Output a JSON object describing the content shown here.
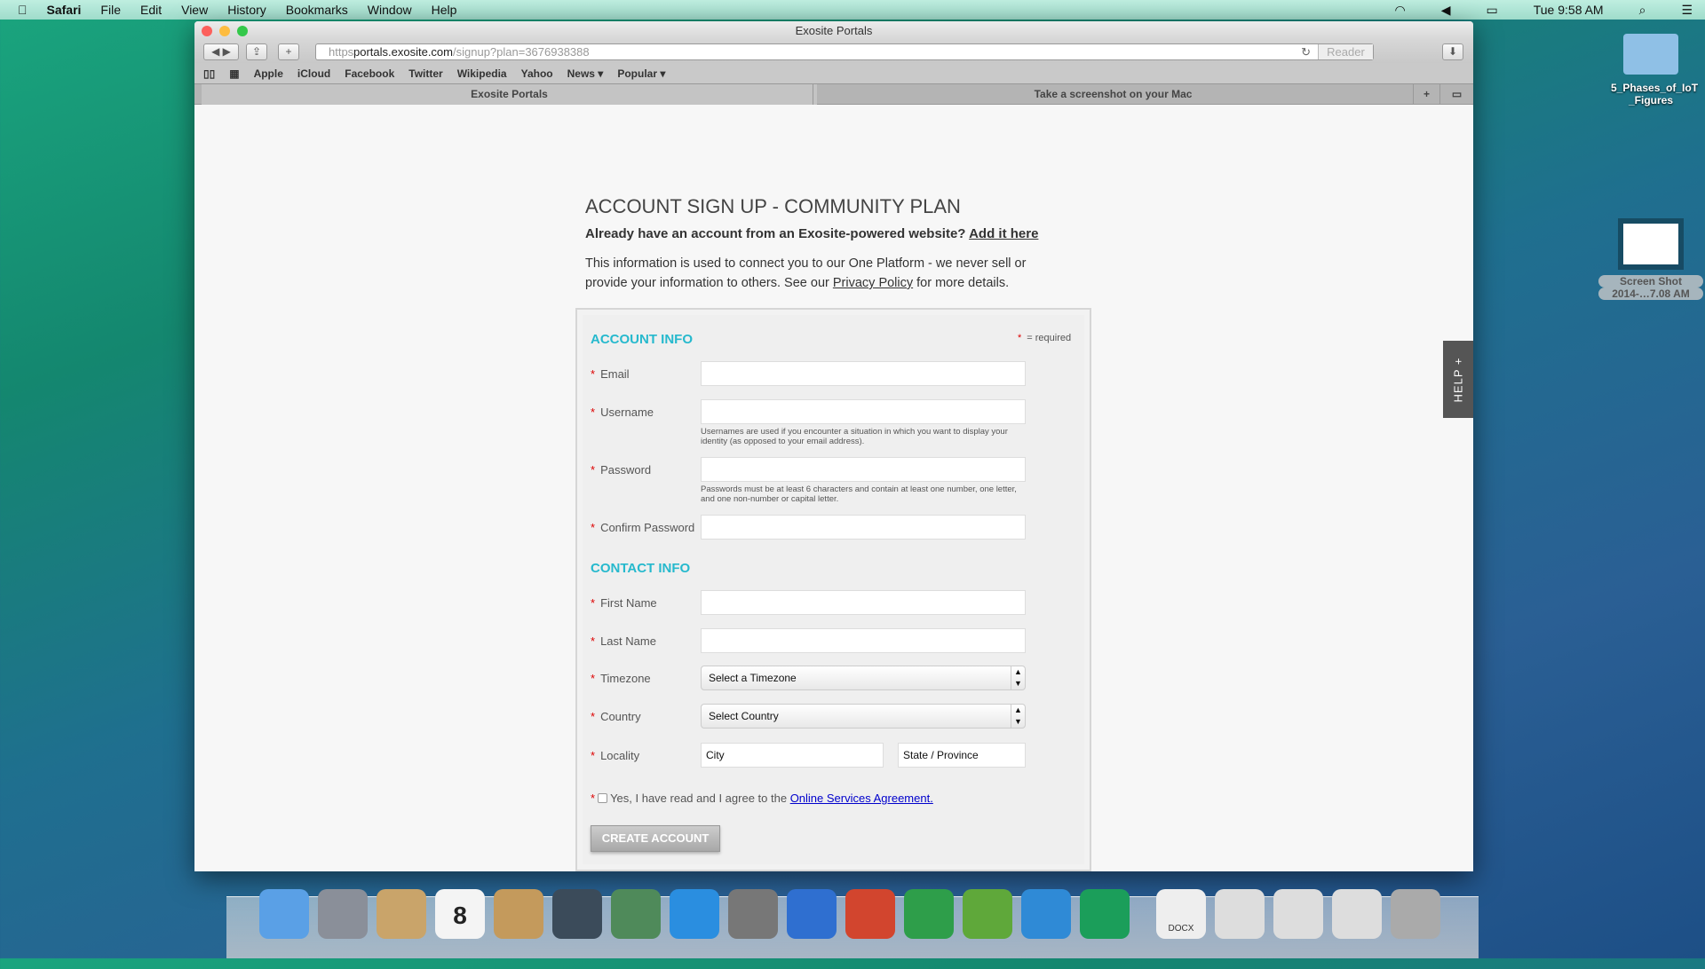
{
  "menubar": {
    "app": "Safari",
    "items": [
      "File",
      "Edit",
      "View",
      "History",
      "Bookmarks",
      "Window",
      "Help"
    ],
    "clock": "Tue 9:58 AM"
  },
  "browser": {
    "title": "Exosite Portals",
    "url_scheme": "https",
    "url_host": "portals.exosite.com",
    "url_path": "/signup?plan=3676938388",
    "reader": "Reader",
    "bookmarks": [
      "Apple",
      "iCloud",
      "Facebook",
      "Twitter",
      "Wikipedia",
      "Yahoo",
      "News ▾",
      "Popular ▾"
    ],
    "tabs": [
      "Exosite Portals",
      "Take a screenshot on your Mac"
    ]
  },
  "page": {
    "heading": "ACCOUNT SIGN UP - COMMUNITY PLAN",
    "already": "Already have an account from an Exosite-powered website?",
    "add_link": "Add it here",
    "info_1": "This information is used to connect you to our One Platform - we never sell or provide your information to others. See our",
    "privacy_link": "Privacy Policy",
    "info_2": "for more details.",
    "help": "HELP +"
  },
  "form": {
    "account_info": "ACCOUNT INFO",
    "required_note": "= required",
    "contact_info": "CONTACT INFO",
    "email": "Email",
    "username": "Username",
    "username_hint": "Usernames are used if you encounter a situation in which you want to display your identity (as opposed to your email address).",
    "password": "Password",
    "password_hint": "Passwords must be at least 6 characters and contain at least one number, one letter, and one non-number or capital letter.",
    "confirm": "Confirm Password",
    "first": "First Name",
    "last": "Last Name",
    "timezone": "Timezone",
    "timezone_value": "Select a Timezone",
    "country": "Country",
    "country_value": "Select Country",
    "locality": "Locality",
    "city_placeholder": "City",
    "state_placeholder": "State / Province",
    "agree": "Yes, I have read and I agree to the",
    "agree_link": "Online Services Agreement.",
    "submit": "CREATE ACCOUNT"
  },
  "desktop": {
    "folder": "5_Phases_of_IoT _Figures",
    "screenshot_1": "Screen Shot",
    "screenshot_2": "2014-…7.08 AM"
  },
  "dock": [
    "Finder",
    "Launchpad",
    "Mail",
    "Calendar",
    "Contacts",
    "FaceTime",
    "iPhoto",
    "iTunes",
    "System Preferences",
    "Word",
    "PowerPoint",
    "Excel",
    "Adium",
    "Safari",
    "MindNode",
    "DOCX",
    "Document",
    "Document",
    "Document",
    "Trash"
  ],
  "calendar_day": "8"
}
